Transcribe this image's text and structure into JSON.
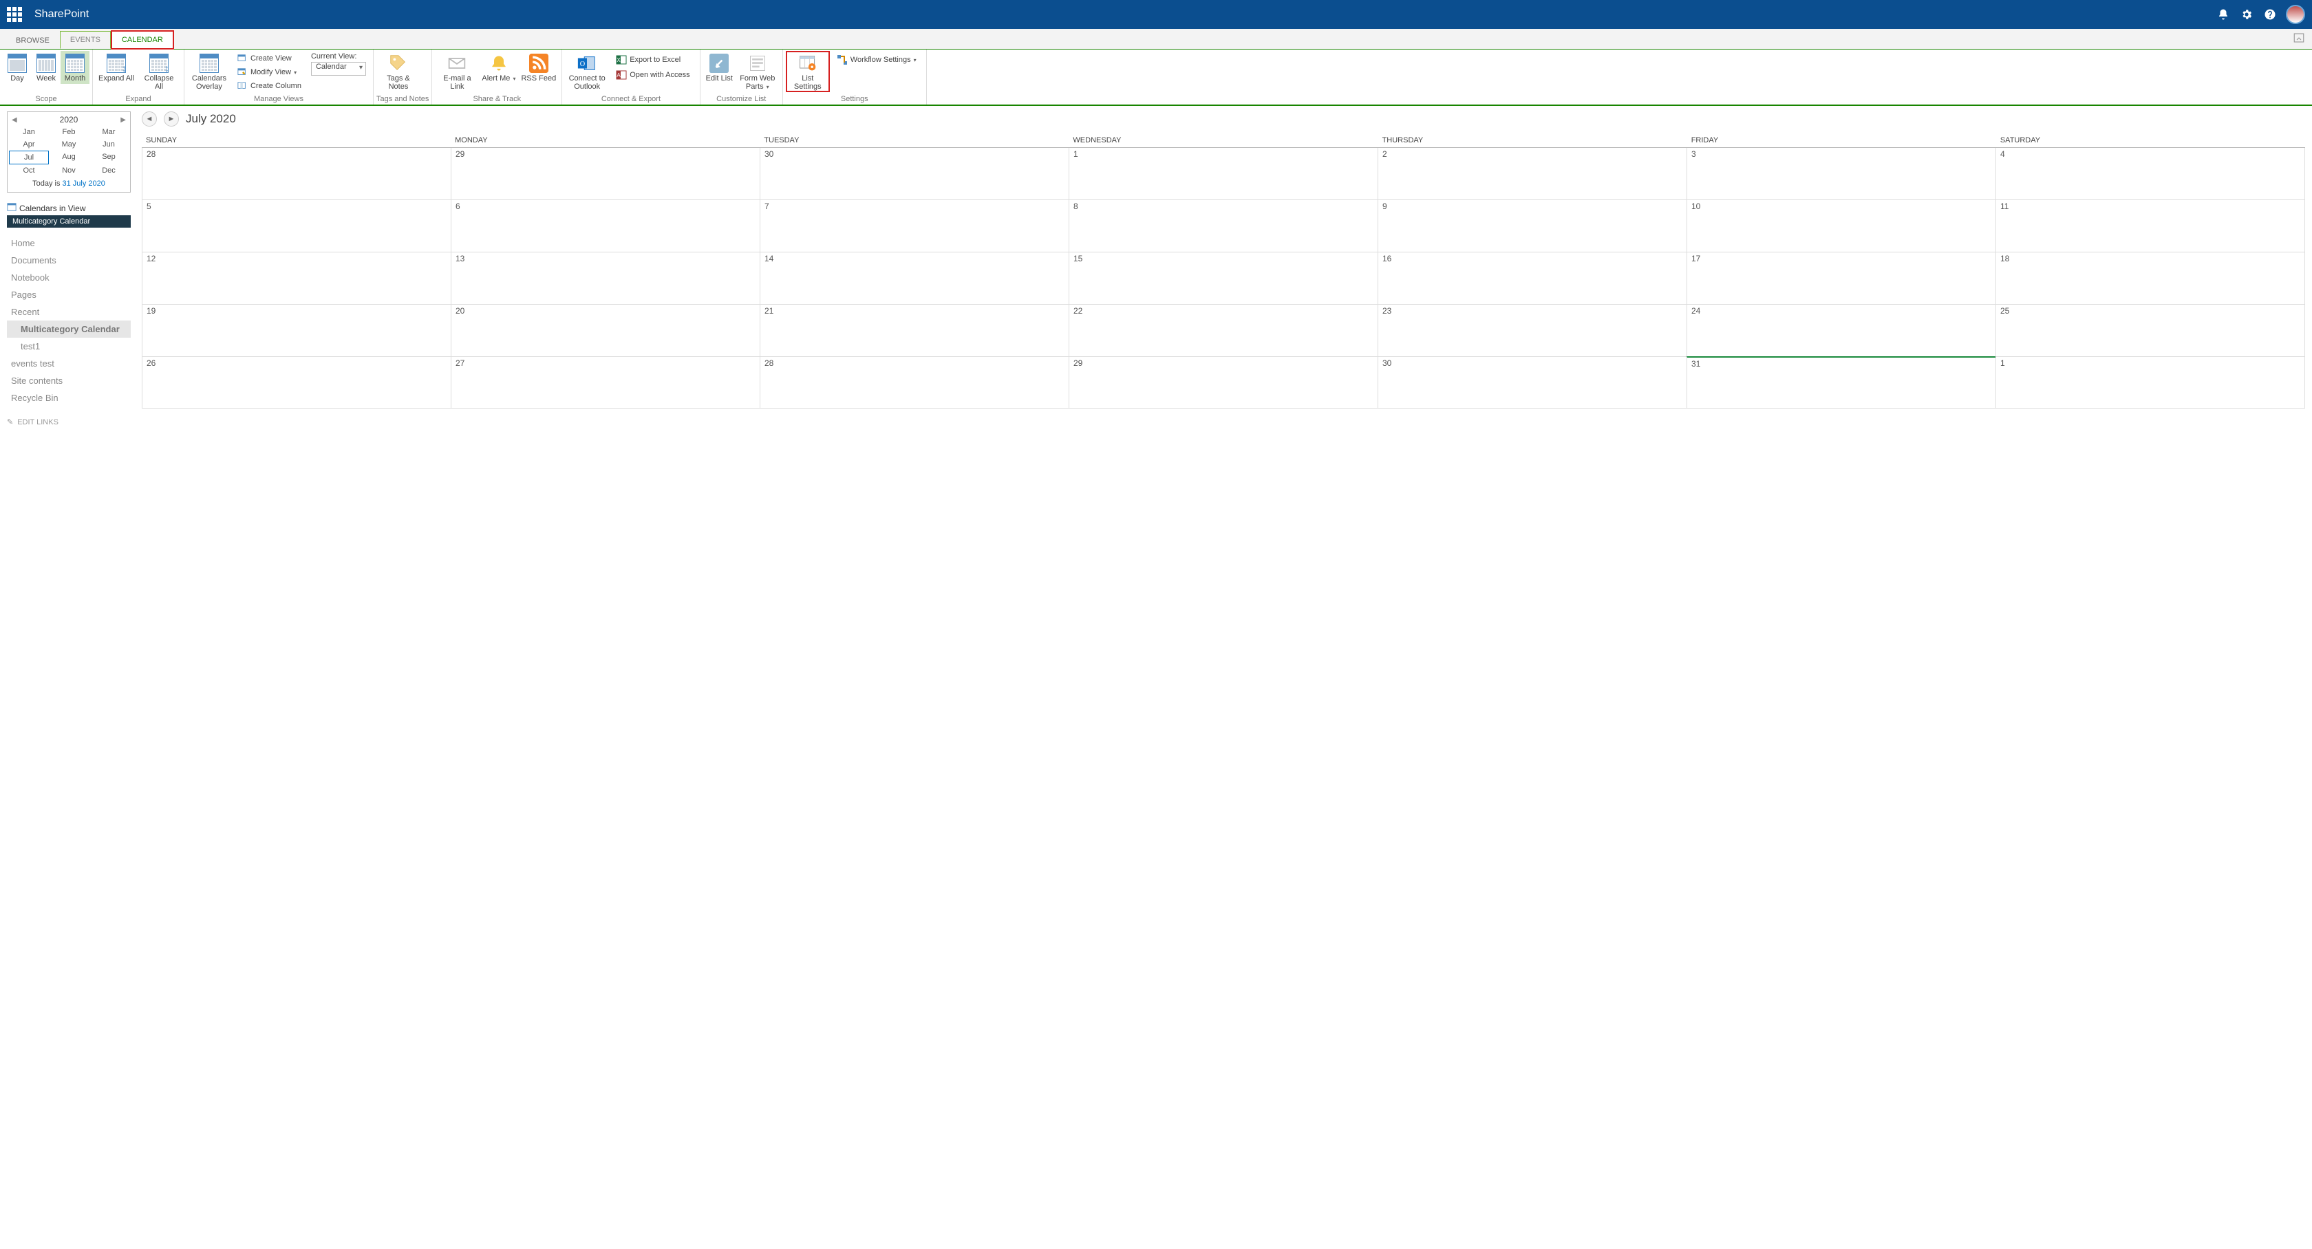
{
  "header": {
    "title": "SharePoint"
  },
  "ribbonTabs": {
    "browse": "BROWSE",
    "events": "EVENTS",
    "calendar": "CALENDAR"
  },
  "ribbon": {
    "scope": {
      "day": "Day",
      "week": "Week",
      "month": "Month",
      "label": "Scope"
    },
    "expand": {
      "expandAll": "Expand All",
      "collapseAll": "Collapse All",
      "label": "Expand"
    },
    "manageViews": {
      "calendarsOverlay": "Calendars Overlay",
      "createView": "Create View",
      "modifyView": "Modify View",
      "createColumn": "Create Column",
      "currentViewLabel": "Current View:",
      "currentViewValue": "Calendar",
      "label": "Manage Views"
    },
    "tags": {
      "tagsNotes": "Tags & Notes",
      "label": "Tags and Notes"
    },
    "share": {
      "emailLink": "E-mail a Link",
      "alertMe": "Alert Me",
      "rss": "RSS Feed",
      "label": "Share & Track"
    },
    "connect": {
      "connectOutlook": "Connect to Outlook",
      "exportExcel": "Export to Excel",
      "openAccess": "Open with Access",
      "label": "Connect & Export"
    },
    "customize": {
      "editList": "Edit List",
      "formWebParts": "Form Web Parts",
      "label": "Customize List"
    },
    "settings": {
      "listSettings": "List Settings",
      "workflowSettings": "Workflow Settings",
      "label": "Settings"
    }
  },
  "miniCal": {
    "year": "2020",
    "months": [
      "Jan",
      "Feb",
      "Mar",
      "Apr",
      "May",
      "Jun",
      "Jul",
      "Aug",
      "Sep",
      "Oct",
      "Nov",
      "Dec"
    ],
    "currentIndex": 6,
    "todayPrefix": "Today is ",
    "todayDate": "31 July 2020"
  },
  "civ": {
    "title": "Calendars in View",
    "item": "Multicategory Calendar"
  },
  "nav": {
    "home": "Home",
    "documents": "Documents",
    "notebook": "Notebook",
    "pages": "Pages",
    "recent": "Recent",
    "multicat": "Multicategory Calendar",
    "test1": "test1",
    "eventsTest": "events test",
    "siteContents": "Site contents",
    "recycleBin": "Recycle Bin",
    "editLinks": "EDIT LINKS"
  },
  "calGrid": {
    "title": "July 2020",
    "days": [
      "SUNDAY",
      "MONDAY",
      "TUESDAY",
      "WEDNESDAY",
      "THURSDAY",
      "FRIDAY",
      "SATURDAY"
    ],
    "weeks": [
      [
        "28",
        "29",
        "30",
        "1",
        "2",
        "3",
        "4"
      ],
      [
        "5",
        "6",
        "7",
        "8",
        "9",
        "10",
        "11"
      ],
      [
        "12",
        "13",
        "14",
        "15",
        "16",
        "17",
        "18"
      ],
      [
        "19",
        "20",
        "21",
        "22",
        "23",
        "24",
        "25"
      ],
      [
        "26",
        "27",
        "28",
        "29",
        "30",
        "31",
        "1"
      ]
    ],
    "todayCell": [
      4,
      5
    ]
  }
}
